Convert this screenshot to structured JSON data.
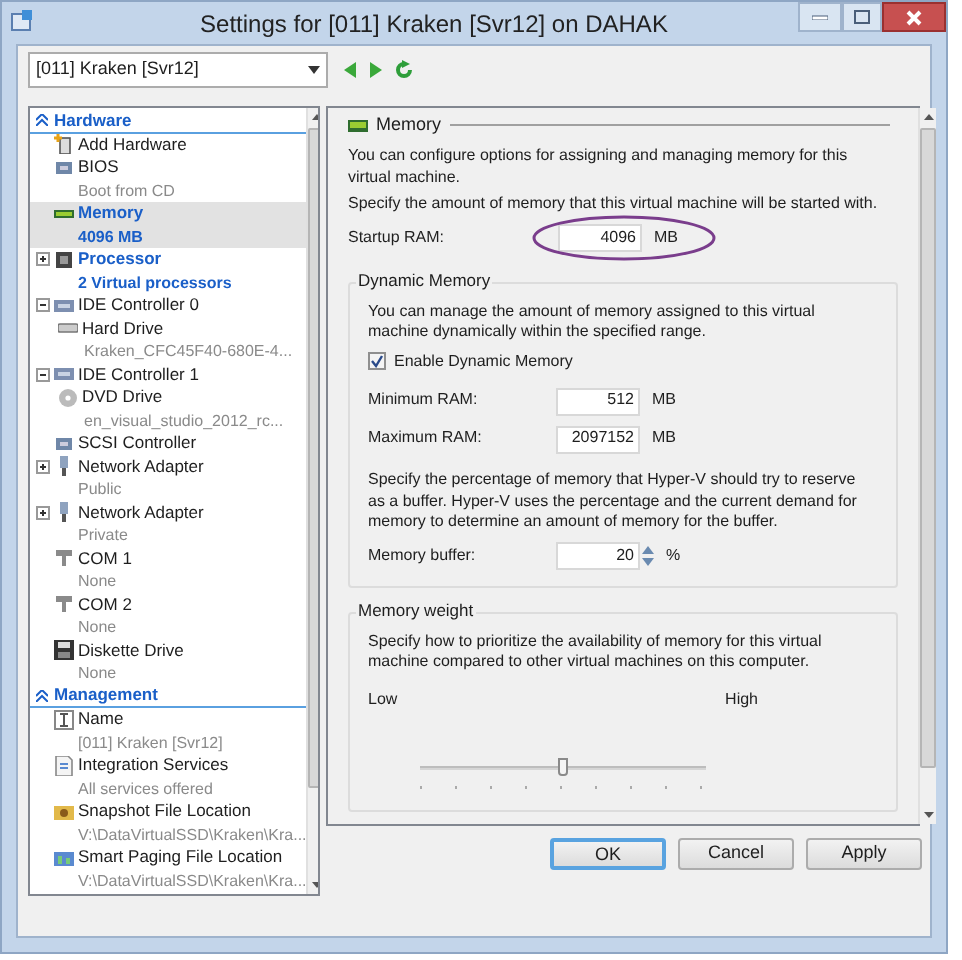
{
  "window": {
    "title": "Settings for [011] Kraken [Svr12] on DAHAK"
  },
  "vm_selector": {
    "value": "[011] Kraken [Svr12]"
  },
  "tree": [
    {
      "heading": "Hardware",
      "items": [
        {
          "label": "Add Hardware",
          "selected": false,
          "emphasized": false
        },
        {
          "label": "BIOS",
          "detail": "Boot from CD",
          "selected": false,
          "emphasized": false
        },
        {
          "label": "Memory",
          "detail": "4096 MB",
          "selected": true,
          "emphasized": true
        },
        {
          "label": "Processor",
          "detail": "2 Virtual processors",
          "selected": false,
          "emphasized": true,
          "expanded": false
        },
        {
          "label": "IDE Controller 0",
          "selected": false,
          "emphasized": false,
          "expanded": true,
          "children": [
            {
              "label": "Hard Drive",
              "detail": "Kraken_CFC45F40-680E-4...",
              "selected": false,
              "emphasized": false
            }
          ]
        },
        {
          "label": "IDE Controller 1",
          "selected": false,
          "emphasized": false,
          "expanded": true,
          "children": [
            {
              "label": "DVD Drive",
              "detail": "en_visual_studio_2012_rc...",
              "selected": false,
              "emphasized": false
            }
          ]
        },
        {
          "label": "SCSI Controller",
          "selected": false,
          "emphasized": false
        },
        {
          "label": "Network Adapter",
          "detail": "Public",
          "selected": false,
          "emphasized": false,
          "expanded": false
        },
        {
          "label": "Network Adapter",
          "detail": "Private",
          "selected": false,
          "emphasized": false,
          "expanded": false
        },
        {
          "label": "COM 1",
          "detail": "None",
          "selected": false,
          "emphasized": false
        },
        {
          "label": "COM 2",
          "detail": "None",
          "selected": false,
          "emphasized": false
        },
        {
          "label": "Diskette Drive",
          "detail": "None",
          "selected": false,
          "emphasized": false
        }
      ]
    },
    {
      "heading": "Management",
      "items": [
        {
          "label": "Name",
          "detail": "[011] Kraken [Svr12]",
          "selected": false,
          "emphasized": false
        },
        {
          "label": "Integration Services",
          "detail": "All services offered",
          "selected": false,
          "emphasized": false
        },
        {
          "label": "Snapshot File Location",
          "detail": "V:\\DataVirtualSSD\\Kraken\\Kra...",
          "selected": false,
          "emphasized": false
        },
        {
          "label": "Smart Paging File Location",
          "detail": "V:\\DataVirtualSSD\\Kraken\\Kra...",
          "selected": false,
          "emphasized": false
        }
      ]
    }
  ],
  "memory_panel": {
    "heading": "Memory",
    "intro": "You can configure options for assigning and managing memory for this virtual machine.",
    "startup_prompt": "Specify the amount of memory that this virtual machine will be started with.",
    "startup_ram": {
      "label": "Startup RAM:",
      "value": "4096",
      "unit": "MB"
    },
    "dynamic_memory": {
      "heading": "Dynamic Memory",
      "description": "You can manage the amount of memory assigned to this virtual machine dynamically within the specified range.",
      "enable": {
        "label": "Enable Dynamic Memory",
        "checked": true
      },
      "minimum": {
        "label": "Minimum RAM:",
        "value": "512",
        "unit": "MB"
      },
      "maximum": {
        "label": "Maximum RAM:",
        "value": "2097152",
        "unit": "MB"
      },
      "buffer_description": "Specify the percentage of memory that Hyper-V should try to reserve as a buffer. Hyper-V uses the percentage and the current demand for memory to determine an amount of memory for the buffer.",
      "buffer": {
        "label": "Memory buffer:",
        "value": "20",
        "unit": "%"
      }
    },
    "memory_weight": {
      "heading": "Memory weight",
      "description": "Specify how to prioritize the availability of memory for this virtual machine compared to other virtual machines on this computer.",
      "low_label": "Low",
      "high_label": "High",
      "level": 0.5
    }
  },
  "buttons": [
    {
      "label": "OK",
      "default": true
    },
    {
      "label": "Cancel",
      "default": false
    },
    {
      "label": "Apply",
      "default": false
    }
  ]
}
